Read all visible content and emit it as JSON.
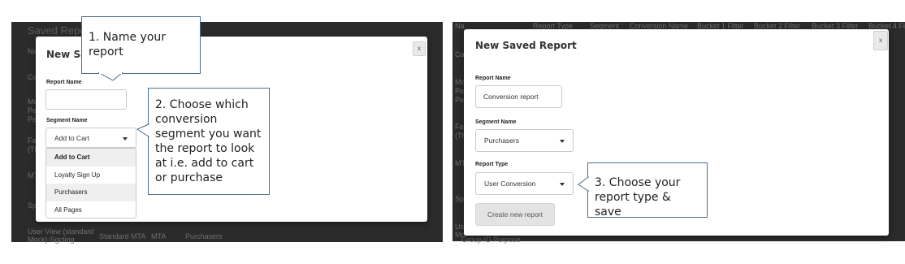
{
  "left": {
    "background_texts": [
      "Saved Repo",
      "Na",
      "Ca",
      "Mo",
      "Pe",
      "Pe",
      "Fa",
      "(Th",
      "MT",
      "Sp"
    ],
    "background_row": {
      "col1a": "User View (standard",
      "col1b": "Mock)-Sgcting",
      "col2": "Standard MTA",
      "col3": "MTA",
      "col4": "Purchasers"
    },
    "modal": {
      "title": "New Sa",
      "close_label": "x",
      "report_name_label": "Report Name",
      "report_name_value": "",
      "segment_label": "Segment Name",
      "segment_selected": "Add to Cart",
      "segment_options": [
        "Add to Cart",
        "Loyalty Sign Up",
        "Purchasers",
        "All Pages"
      ]
    },
    "callout_1": "1. Name your\nreport",
    "callout_2": "2. Choose which\nconversion\nsegment you want\nthe report to look\nat i.e. add to cart\nor purchase"
  },
  "right": {
    "background_header": [
      "Na",
      "Report Type",
      "Segment",
      "Conversion Name",
      "Bucket 1 Filter",
      "Bucket 2 Filter",
      "Bucket 3 Filter",
      "Bucket 4 Fi"
    ],
    "background_texts": [
      "Ca",
      "Mo",
      "Pe",
      "Pe",
      "Fa",
      "(Th",
      "MT",
      "Sp",
      "Us",
      "Mo"
    ],
    "background_bottom": "Group ID Purpose",
    "modal": {
      "title": "New Saved Report",
      "close_label": "x",
      "report_name_label": "Report Name",
      "report_name_value": "Conversion report",
      "segment_label": "Segment Name",
      "segment_selected": "Purchasers",
      "report_type_label": "Report Type",
      "report_type_selected": "User Conversion",
      "create_button": "Create new report"
    },
    "callout_3": "3. Choose your\nreport type & save"
  },
  "colors": {
    "backdrop": "#2b2b2b",
    "callout_border": "#4a6f8d",
    "modal": "#ffffff"
  }
}
